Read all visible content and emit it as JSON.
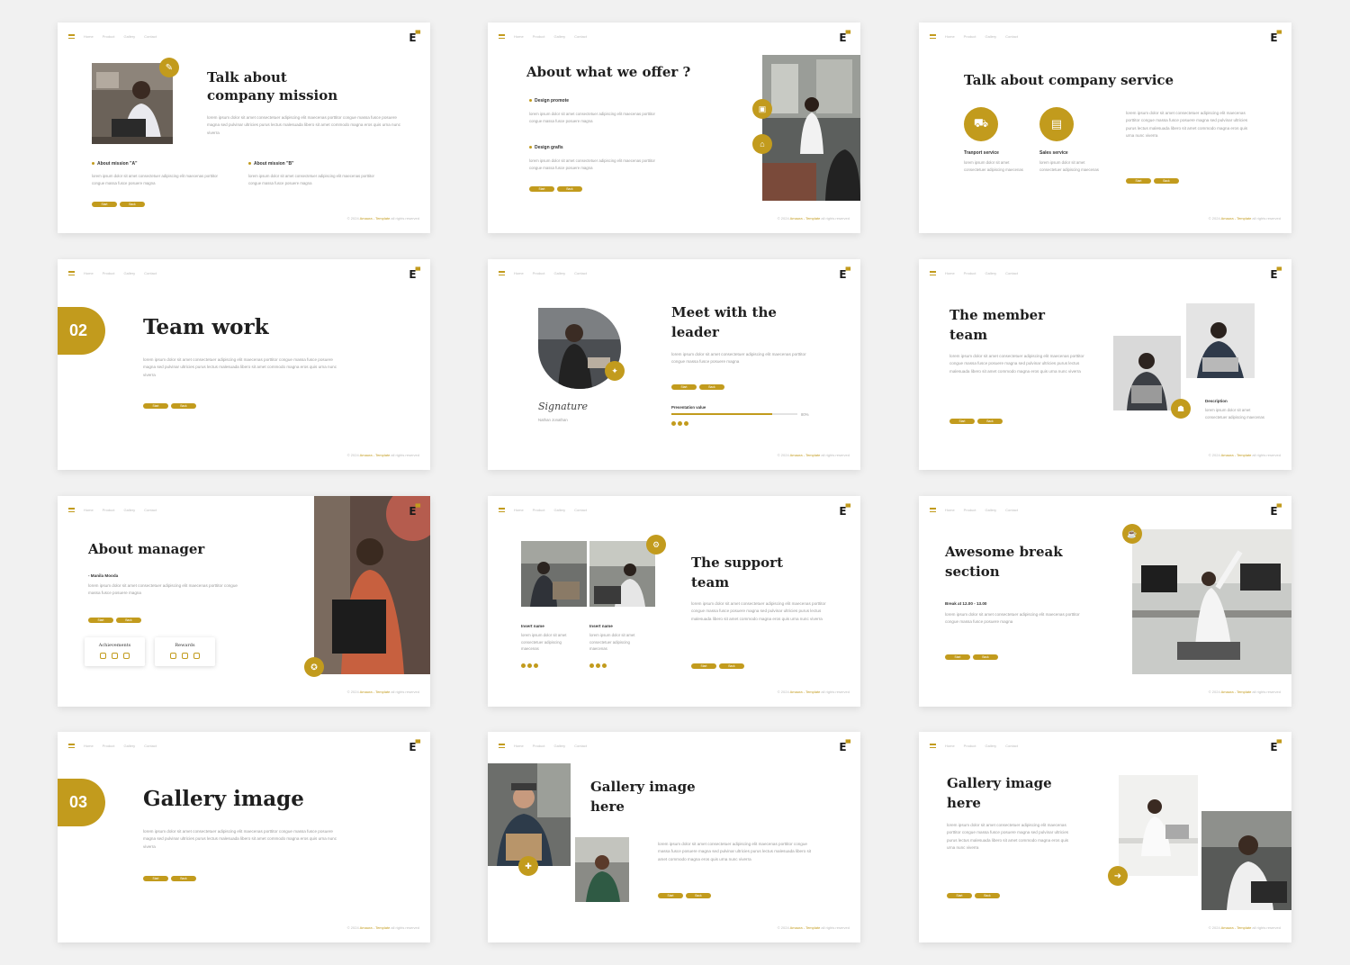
{
  "colors": {
    "accent": "#c29b1d",
    "background": "#f1f1f1",
    "slide": "#ffffff",
    "title": "#1f1f1f"
  },
  "common": {
    "nav": [
      "Home",
      "Product",
      "Gallery",
      "Contact"
    ],
    "logo": "E",
    "footer_prefix": "© 2024",
    "footer_brand": "Amaura - Template",
    "footer_suffix": "all rights reserved",
    "btn_start": "Start",
    "btn_back": "Back",
    "lorem_long": "lorem ipsum dolor sit amet consectetuer adipiscing elit maecenas porttitor congue massa fusce posuere magna sed pulvinar ultricies purus lectus malesuada libero sit amet commodo magna eros quis urna nunc viverra",
    "lorem_mid": "lorem ipsum dolor sit amet consectetuer adipiscing elit maecenas porttitor congue massa fusce posuere magna",
    "lorem_short": "lorem ipsum dolor sit amet consectetuer adipiscing maecenas"
  },
  "slides": {
    "s1": {
      "title": "Talk about company mission",
      "label_a": "About mission \"A\"",
      "label_b": "About mission \"B\""
    },
    "s2": {
      "title": "About what we offer ?",
      "label_a": "Design promote",
      "label_b": "Design grafis"
    },
    "s3": {
      "title": "Talk about company service",
      "label_a": "Tranport service",
      "label_b": "Sales service"
    },
    "s4": {
      "badge": "02",
      "title": "Team work"
    },
    "s5": {
      "title": "Meet with the leader",
      "signature": "Signature",
      "sig_caption": "Nathan Jonathan",
      "progress_label": "Presentation value",
      "progress": 0.8,
      "progress_value": "80%"
    },
    "s6": {
      "title": "The member team",
      "desc_label": "Description"
    },
    "s7": {
      "title": "About manager",
      "name": "- Manila Mooda",
      "card_a": "Achievements",
      "card_b": "Rewards"
    },
    "s8": {
      "title": "The support team",
      "name_a": "Insert name",
      "name_b": "Insert name"
    },
    "s9": {
      "title": "Awesome break section",
      "time": "Break at 12.00 - 13.00"
    },
    "s10": {
      "badge": "03",
      "title": "Gallery image"
    },
    "s11": {
      "title": "Gallery image here"
    },
    "s12": {
      "title": "Gallery image here"
    }
  }
}
